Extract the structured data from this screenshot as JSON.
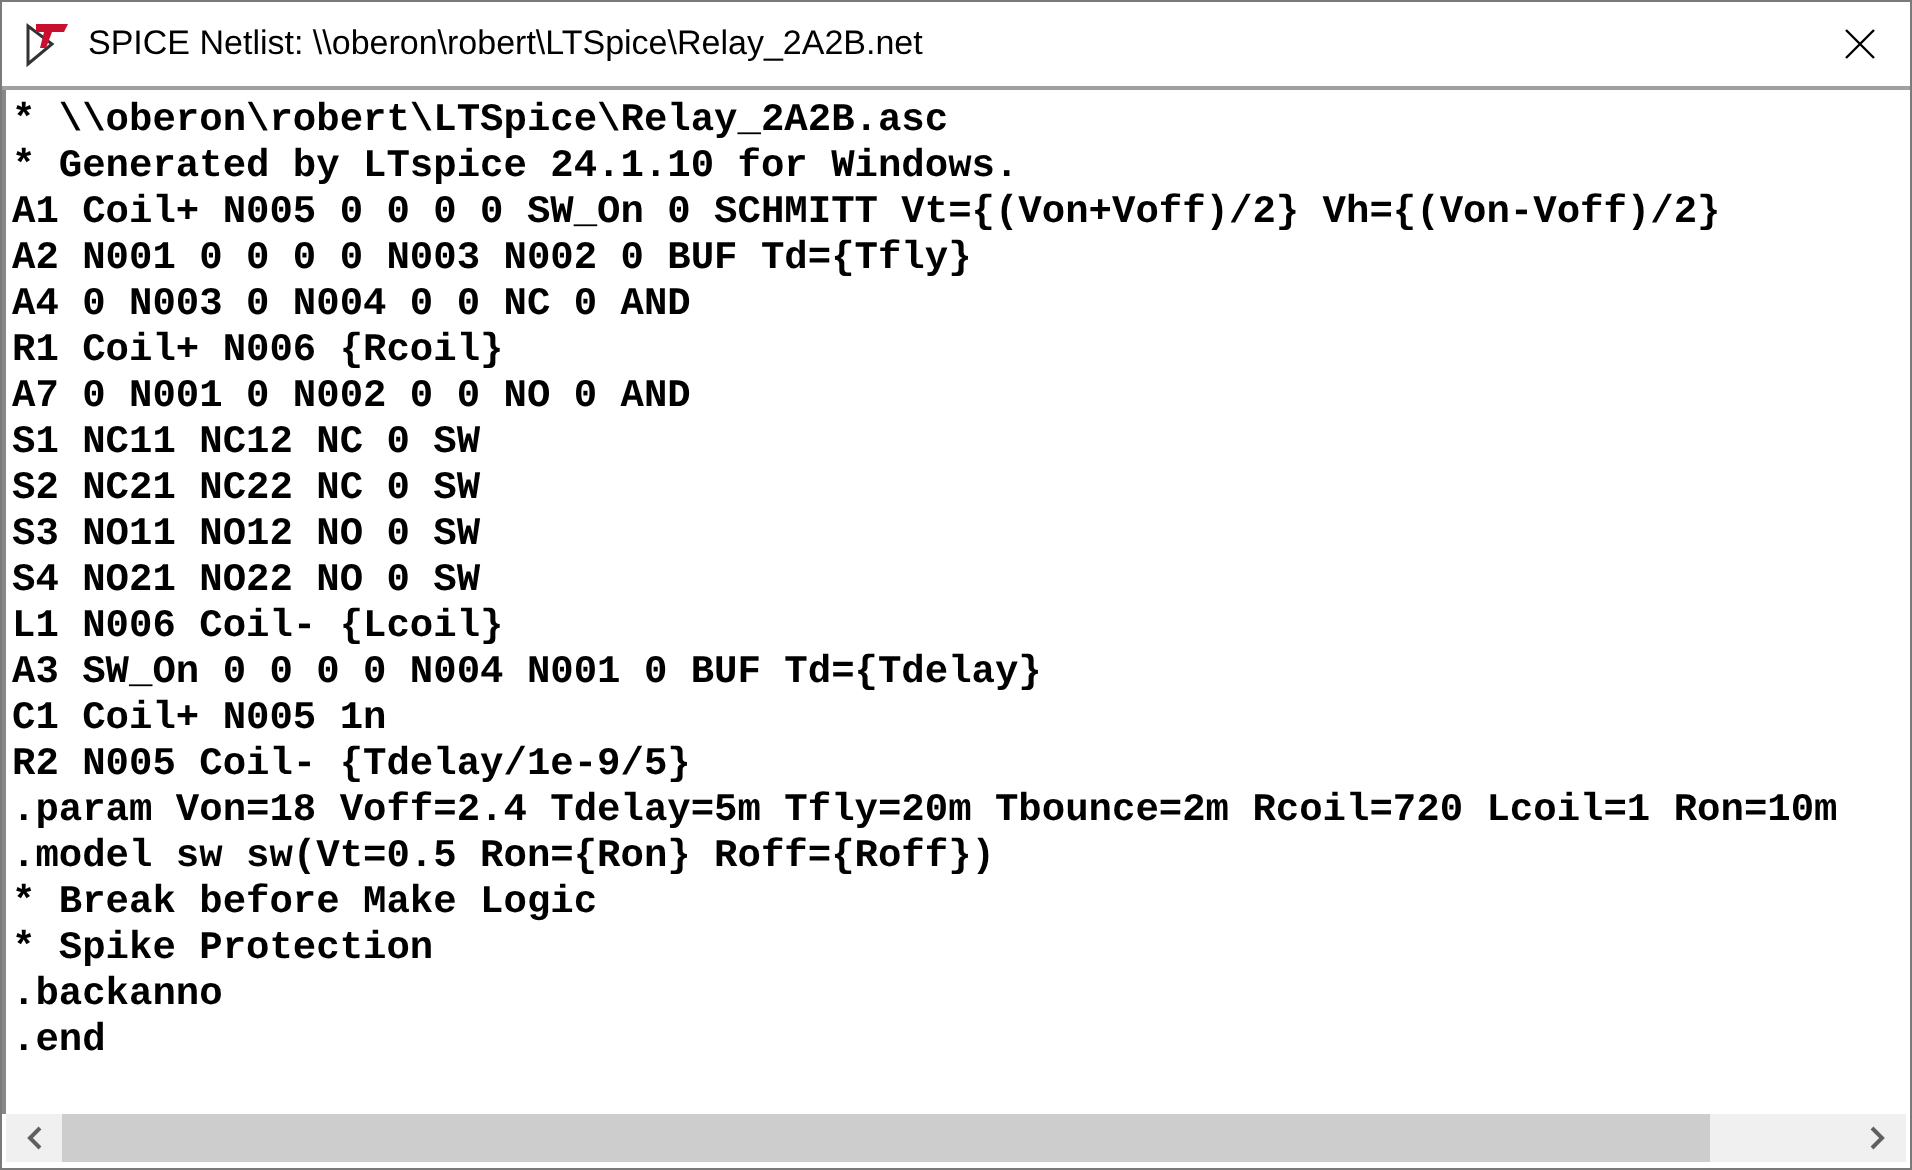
{
  "window": {
    "title": "SPICE Netlist: \\\\oberon\\robert\\LTSpice\\Relay_2A2B.net"
  },
  "netlist_lines": [
    "* \\\\oberon\\robert\\LTSpice\\Relay_2A2B.asc",
    "* Generated by LTspice 24.1.10 for Windows.",
    "A1 Coil+ N005 0 0 0 0 SW_On 0 SCHMITT Vt={(Von+Voff)/2} Vh={(Von-Voff)/2}",
    "A2 N001 0 0 0 0 N003 N002 0 BUF Td={Tfly}",
    "A4 0 N003 0 N004 0 0 NC 0 AND",
    "R1 Coil+ N006 {Rcoil}",
    "A7 0 N001 0 N002 0 0 NO 0 AND",
    "S1 NC11 NC12 NC 0 SW",
    "S2 NC21 NC22 NC 0 SW",
    "S3 NO11 NO12 NO 0 SW",
    "S4 NO21 NO22 NO 0 SW",
    "L1 N006 Coil- {Lcoil}",
    "A3 SW_On 0 0 0 0 N004 N001 0 BUF Td={Tdelay}",
    "C1 Coil+ N005 1n",
    "R2 N005 Coil- {Tdelay/1e-9/5}",
    ".param Von=18 Voff=2.4 Tdelay=5m Tfly=20m Tbounce=2m Rcoil=720 Lcoil=1 Ron=10m",
    ".model sw sw(Vt=0.5 Ron={Ron} Roff={Roff})",
    "* Break before Make Logic",
    "* Spike Protection",
    ".backanno",
    ".end"
  ]
}
